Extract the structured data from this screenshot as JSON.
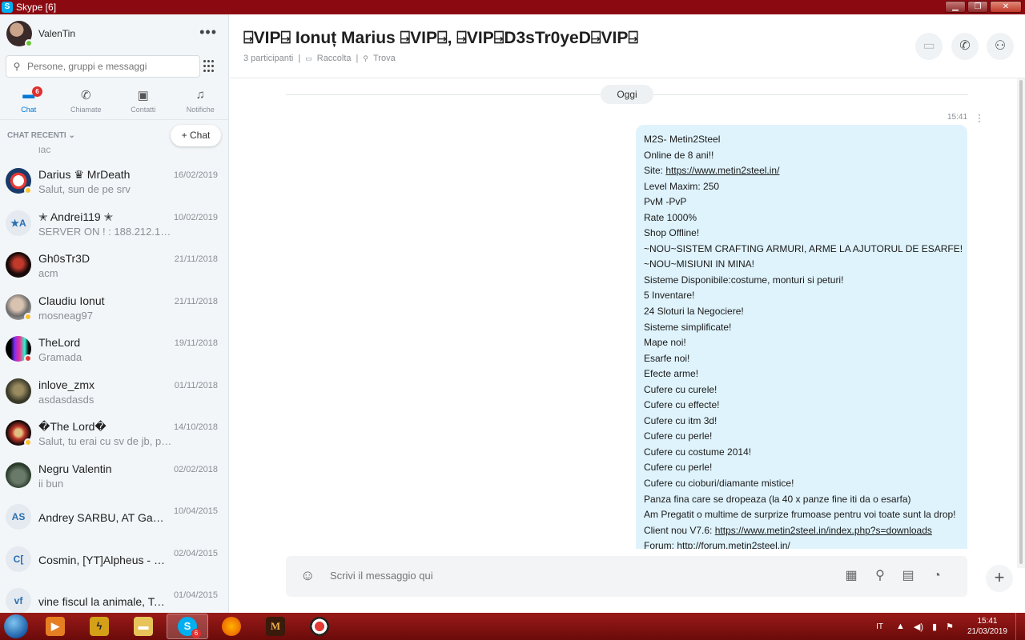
{
  "window": {
    "title": "Skype [6]"
  },
  "profile": {
    "name": "ValenTin"
  },
  "search": {
    "placeholder": "Persone, gruppi e messaggi"
  },
  "nav": {
    "chat_label": "Chat",
    "chat_badge": "6",
    "calls_label": "Chiamate",
    "contacts_label": "Contatti",
    "notifications_label": "Notifiche"
  },
  "recent": {
    "title": "CHAT RECENTI",
    "new_chat_label": "+  Chat"
  },
  "chats": [
    {
      "name": "Darius ♛ MrDeath",
      "message": "Salut, sun de pe srv",
      "date": "16/02/2019"
    },
    {
      "name": "✭ Andrei119 ✭",
      "message": "SERVER ON ! : 188.212.100....",
      "date": "10/02/2019",
      "initials": "★A"
    },
    {
      "name": "Gh0sTr3D",
      "message": "acm",
      "date": "21/11/2018"
    },
    {
      "name": "Claudiu Ionut",
      "message": "mosneag97",
      "date": "21/11/2018"
    },
    {
      "name": "TheLord",
      "message": "Gramada",
      "date": "19/11/2018"
    },
    {
      "name": "inlove_zmx",
      "message": "asdasdasds",
      "date": "01/11/2018"
    },
    {
      "name": "�The Lord�",
      "message": "Salut, tu erai cu sv de jb, pa...",
      "date": "14/10/2018"
    },
    {
      "name": "Negru Valentin",
      "message": "ii bun",
      "date": "02/02/2018"
    },
    {
      "name": "Andrey SARBU, AT GabyRO",
      "message": "",
      "date": "10/04/2015",
      "initials": "AS"
    },
    {
      "name": "Cosmin, [YT]Alpheus - Fr...",
      "message": "",
      "date": "02/04/2015",
      "initials": "C["
    },
    {
      "name": "vine fiscul la animale, Tof...",
      "message": "",
      "date": "01/04/2015",
      "initials": "vf"
    }
  ],
  "chat_cut_text": "lac",
  "conversation": {
    "title": "⍈VIP⍈ Ionuț Marius ⍈VIP⍈, ⍈VIP⍈D3sTr0yeD⍈VIP⍈",
    "participants": "3 participanti",
    "gallery": "Raccolta",
    "find": "Trova",
    "day_label": "Oggi",
    "time": "15:41",
    "message_lines": [
      "M2S- Metin2Steel",
      "Online de 8 ani!!",
      "Site: https://www.metin2steel.in/",
      "Level Maxim: 250",
      "PvM -PvP",
      "Rate 1000%",
      "Shop Offline!",
      "~NOU~SISTEM CRAFTING ARMURI, ARME LA AJUTORUL DE ESARFE!",
      "~NOU~MISIUNI IN MINA!",
      "Sisteme Disponibile:costume, monturi si peturi!",
      "5 Inventare!",
      "24 Sloturi la Negociere!",
      "Sisteme simplificate!",
      "Mape noi!",
      "Esarfe noi!",
      "Efecte arme!",
      "Cufere cu curele!",
      "Cufere cu effecte!",
      "Cufere cu itm 3d!",
      "Cufere cu perle!",
      "Cufere cu costume 2014!",
      "Cufere cu perle!",
      "Cufere cu cioburi/diamante mistice!",
      "Panza fina care se dropeaza (la 40 x panze fine iti da o esarfa)",
      "Am Pregatit o multime de surprize frumoase pentru voi toate sunt la drop!",
      "Client nou V7.6: https://www.metin2steel.in/index.php?s=downloads",
      "Forum: http://forum.metin2steel.in/"
    ]
  },
  "composer": {
    "placeholder": "Scrivi il messaggio qui"
  },
  "taskbar": {
    "skype_badge": "6",
    "lang": "IT",
    "time": "15:41",
    "date": "21/03/2019"
  }
}
